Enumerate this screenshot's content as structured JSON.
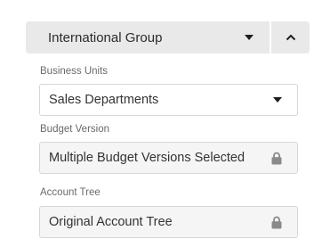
{
  "group": {
    "selected": "International Group"
  },
  "fields": {
    "business_units": {
      "label": "Business Units",
      "value": "Sales Departments"
    },
    "budget_version": {
      "label": "Budget Version",
      "value": "Multiple Budget Versions Selected"
    },
    "account_tree": {
      "label": "Account Tree",
      "value": "Original Account Tree"
    }
  },
  "icons": {
    "group_dropdown": "caret-down-icon",
    "collapse": "chevron-up-icon",
    "business_units_dropdown": "caret-down-icon",
    "budget_version_state": "lock-icon",
    "account_tree_state": "lock-icon"
  },
  "colors": {
    "header_bg": "#e9e9e9",
    "locked_field_bg": "#f5f5f5",
    "field_border": "#d7d7d7",
    "label_text": "#6a6a6a",
    "icon_dark": "#1e1e1e",
    "lock_gray": "#8a8a8a"
  }
}
